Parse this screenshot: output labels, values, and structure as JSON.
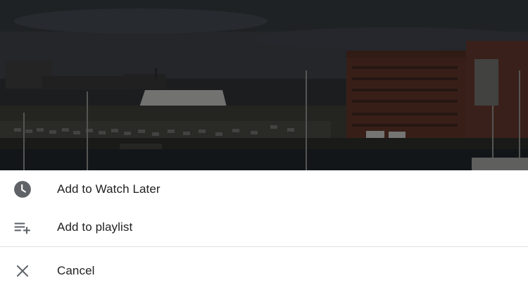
{
  "thumbnail": {
    "description_icon": "video-thumbnail-image",
    "dimmed": true
  },
  "menu": {
    "items": [
      {
        "label": "Add to Watch Later",
        "icon": "clock-icon"
      },
      {
        "label": "Add to playlist",
        "icon": "playlist-add-icon"
      }
    ],
    "cancel": {
      "label": "Cancel",
      "icon": "close-icon"
    }
  },
  "colors": {
    "text": "#212121",
    "icon": "#5f6368",
    "divider": "#e0e0e0",
    "background": "#ffffff"
  }
}
